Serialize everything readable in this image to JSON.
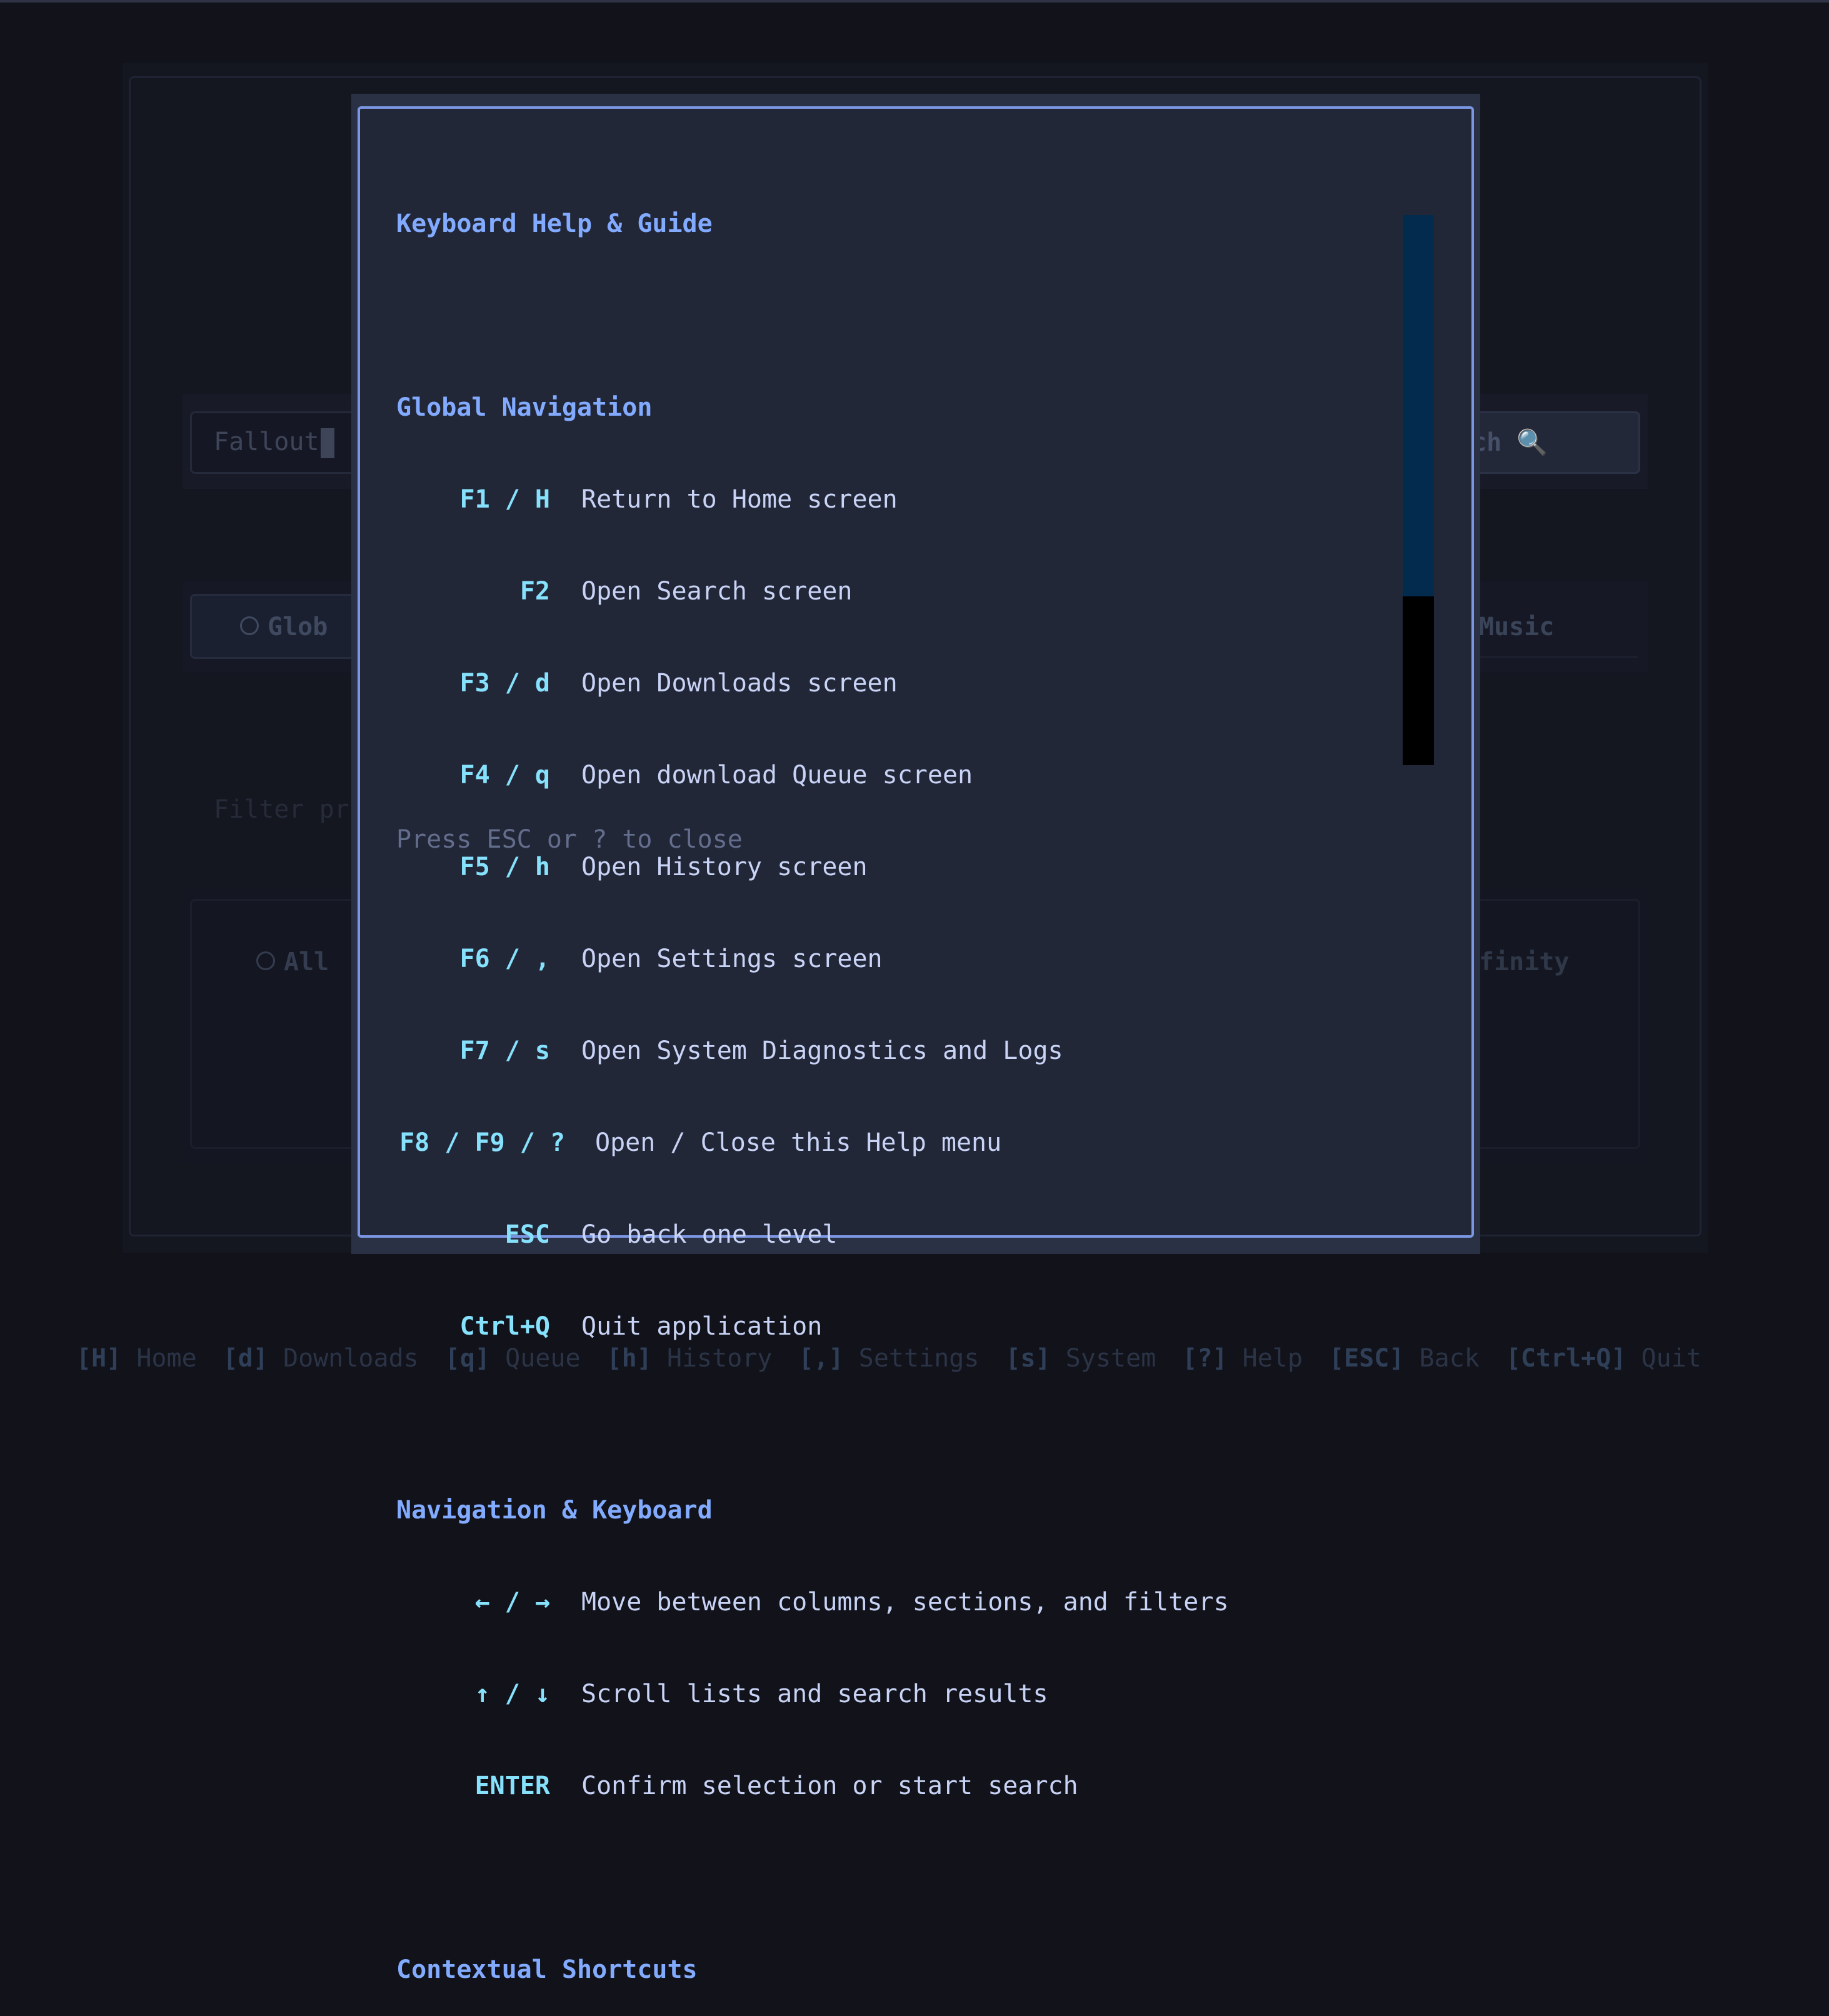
{
  "background": {
    "search_value": "Fallout",
    "search_button_label": "rch",
    "tab_global_label": "Glob",
    "tab_music_label": "Music",
    "filter_placeholder": "Filter pr",
    "results_all_label": "All",
    "results_right_label": "finity"
  },
  "help": {
    "title": "Keyboard Help & Guide",
    "global_nav": {
      "heading": "Global Navigation",
      "rows": [
        {
          "key": "F1 / H",
          "desc": "Return to Home screen"
        },
        {
          "key": "F2",
          "desc": "Open Search screen"
        },
        {
          "key": "F3 / d",
          "desc": "Open Downloads screen"
        },
        {
          "key": "F4 / q",
          "desc": "Open download Queue screen"
        },
        {
          "key": "F5 / h",
          "desc": "Open History screen"
        },
        {
          "key": "F6 / ,",
          "desc": "Open Settings screen"
        },
        {
          "key": "F7 / s",
          "desc": "Open System Diagnostics and Logs"
        },
        {
          "key": "F8 / F9 / ?",
          "desc": "Open / Close this Help menu"
        },
        {
          "key": "ESC",
          "desc": "Go back one level"
        },
        {
          "key": "Ctrl+Q",
          "desc": "Quit application"
        }
      ]
    },
    "nav_keyboard": {
      "heading": "Navigation & Keyboard",
      "rows": [
        {
          "key": "← / →",
          "desc": "Move between columns, sections, and filters"
        },
        {
          "key": "↑ / ↓",
          "desc": "Scroll lists and search results"
        },
        {
          "key": "ENTER",
          "desc": "Confirm selection or start search"
        }
      ]
    },
    "contextual_heading": "Contextual Shortcuts",
    "close_hint": "Press ESC or ? to close"
  },
  "footer": [
    {
      "key": "[H]",
      "label": "Home"
    },
    {
      "key": "[d]",
      "label": "Downloads"
    },
    {
      "key": "[q]",
      "label": "Queue"
    },
    {
      "key": "[h]",
      "label": "History"
    },
    {
      "key": "[,]",
      "label": "Settings"
    },
    {
      "key": "[s]",
      "label": "System"
    },
    {
      "key": "[?]",
      "label": "Help"
    },
    {
      "key": "[ESC]",
      "label": "Back"
    },
    {
      "key": "[Ctrl+Q]",
      "label": "Quit"
    }
  ],
  "colors": {
    "accent": "#82aaff",
    "key": "#86e1fc",
    "modal_border": "#7b96e3",
    "scroll_thumb": "#022b4e"
  }
}
